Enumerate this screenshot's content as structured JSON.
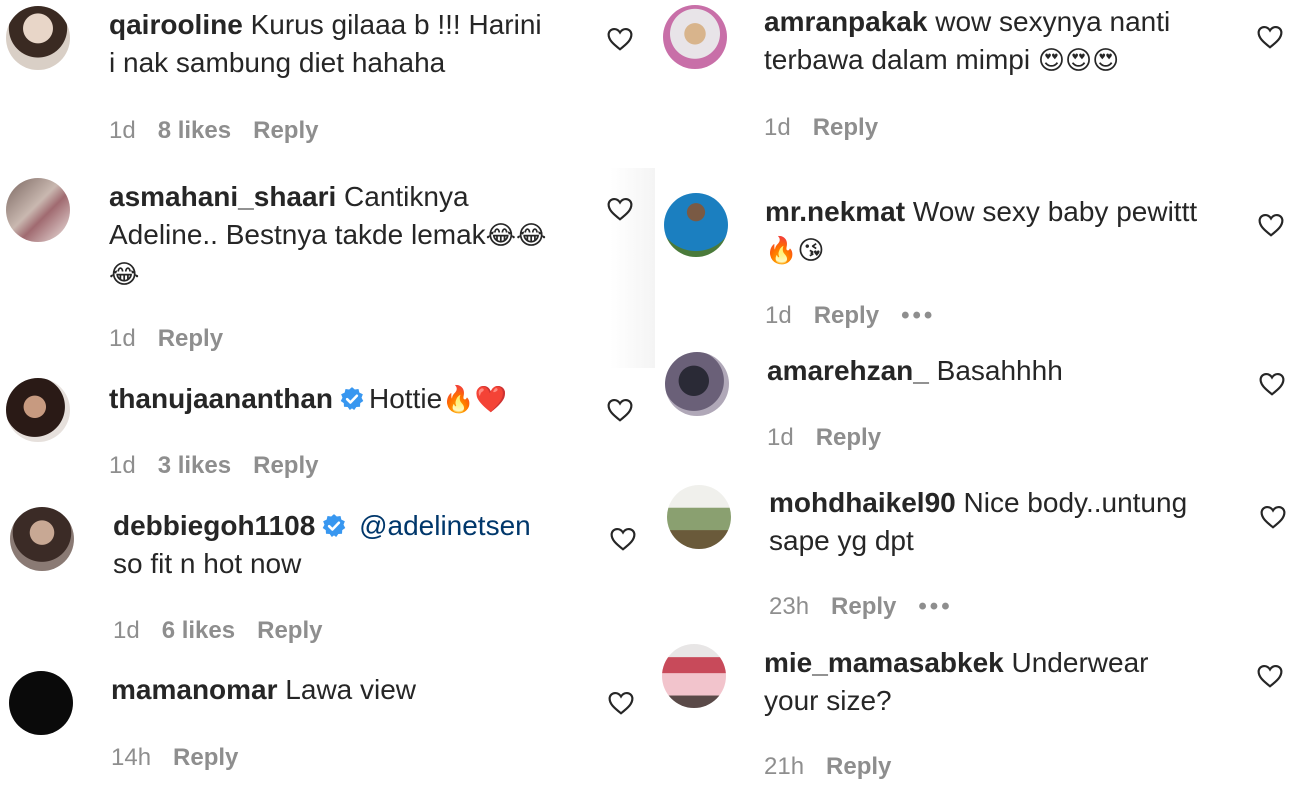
{
  "comments_left": [
    {
      "username": "qairooline",
      "text": " Kurus gilaaa b !!! Harini",
      "text2": "i nak sambung diet hahaha",
      "time": "1d",
      "likes": "8 likes",
      "reply": "Reply"
    },
    {
      "username": "asmahani_shaari",
      "text": " Cantiknya",
      "text2": "Adeline.. Bestnya takde lemak",
      "emoji": "😂😂",
      "emoji2": "😂",
      "time": "1d",
      "reply": "Reply"
    },
    {
      "username": "thanujaananthan",
      "text": "Hottie",
      "emoji": "🔥❤️",
      "time": "1d",
      "likes": "3 likes",
      "reply": "Reply"
    },
    {
      "username": "debbiegoh1108",
      "mention": "@adelinetsen",
      "text2": "so fit n hot now",
      "time": "1d",
      "likes": "6 likes",
      "reply": "Reply"
    },
    {
      "username": "mamanomar",
      "text": " Lawa view",
      "time": "14h",
      "reply": "Reply"
    }
  ],
  "comments_right": [
    {
      "username": "amranpakak",
      "text": " wow sexynya nanti",
      "text2": "terbawa dalam mimpi ",
      "emoji": "😍😍😍",
      "time": "1d",
      "reply": "Reply"
    },
    {
      "username": "mr.nekmat",
      "text": " Wow sexy baby pewittt",
      "emoji": "🔥😘",
      "time": "1d",
      "reply": "Reply",
      "more": "•••"
    },
    {
      "username": "amarehzan_",
      "text": " Basahhhh",
      "time": "1d",
      "reply": "Reply"
    },
    {
      "username": "mohdhaikel90",
      "text": " Nice body..untung",
      "text2": "sape yg dpt",
      "time": "23h",
      "reply": "Reply",
      "more": "•••"
    },
    {
      "username": "mie_mamasabkek",
      "text": " Underwear",
      "text2": "your size?",
      "time": "21h",
      "reply": "Reply"
    }
  ],
  "colors": {
    "text": "#262626",
    "meta": "#8e8e8e",
    "mention": "#00376b",
    "verified": "#3897f0"
  },
  "icons": {
    "like": "heart-outline-icon",
    "verified": "verified-badge-icon",
    "more": "more-options-icon"
  }
}
